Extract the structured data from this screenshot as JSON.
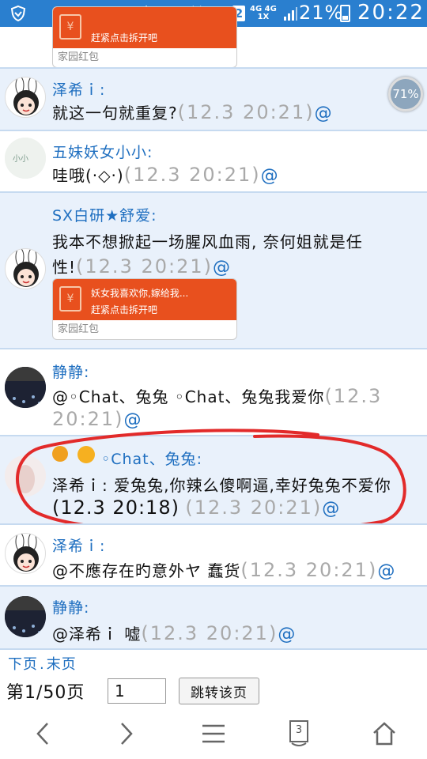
{
  "status_bar": {
    "battery_pct": "21%",
    "time": "20:22",
    "net_top": "4G 4G",
    "net_bottom": "1X",
    "sim_slot": "2",
    "icons": [
      "shield-icon",
      "nfc-icon",
      "mute-icon",
      "alarm-icon",
      "wifi-icon",
      "signal-icon",
      "battery-icon"
    ]
  },
  "badge": {
    "value": "71%"
  },
  "packet_top": {
    "footer": "家园红包",
    "line2": "赶紧点击拆开吧"
  },
  "posts": [
    {
      "user": "泽希ｉ:",
      "text": "就这一句就重复?",
      "time": "(12.3 20:21)",
      "at": "@"
    },
    {
      "user": "五妹妖女小小:",
      "text": "哇哦(·◇·)",
      "time": "(12.3 20:21)",
      "at": "@"
    },
    {
      "user": "SX白研★舒爱:",
      "text_line1": "我本不想掀起一场腥风血雨, 奈何姐就是任",
      "text_line2": "性!",
      "time": "(12.3 20:21)",
      "at": "@",
      "packet": {
        "line1": "妖女我喜欢你,嫁给我...",
        "line2": "赶紧点击拆开吧",
        "footer": "家园红包"
      }
    },
    {
      "user": "静静:",
      "text_line1": "@◦Chat、兔兔 ◦Chat、兔兔我爱你",
      "time_part1": "(12.3",
      "time_part2": "20:21)",
      "at": "@"
    },
    {
      "user": "◦Chat、兔兔:",
      "text_line1": "泽希ｉ: 爱兔兔,你辣么傻啊逼,幸好兔兔不爱你",
      "quote_time": "(12.3 20:18)",
      "time": "(12.3 20:21)",
      "at": "@"
    },
    {
      "user": "泽希ｉ:",
      "text": "@不應存在旳意外ヤ 蠢货",
      "time": "(12.3 20:21)",
      "at": "@"
    },
    {
      "user": "静静:",
      "text": "@泽希ｉ 嘘",
      "time": "(12.3 20:21)",
      "at": "@"
    }
  ],
  "pager": {
    "next": "下页",
    "dot": ".",
    "last": "末页",
    "info": "第1/50页",
    "input_value": "1",
    "jump_label": "跳转该页"
  },
  "nav": {
    "tabs_count": "3"
  },
  "colors": {
    "status_bar": "#2a7fcf",
    "username": "#1f6fc0",
    "timestamp": "#a9a9a9",
    "post_blue": "#e9f1fb",
    "red_packet": "#e8501e",
    "annotation": "#e22a2a"
  }
}
